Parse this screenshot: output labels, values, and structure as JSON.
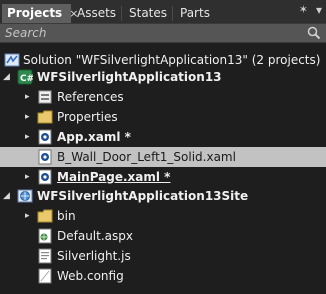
{
  "tabs": [
    {
      "label": "Projects",
      "active": true,
      "close": "×"
    },
    {
      "label": "Assets",
      "active": false
    },
    {
      "label": "States",
      "active": false
    },
    {
      "label": "Parts",
      "active": false
    }
  ],
  "window_controls": {
    "pin": "✶",
    "close": "▾"
  },
  "search": {
    "placeholder": "Search",
    "value": ""
  },
  "tree": {
    "solution": {
      "label": "Solution \"WFSilverlightApplication13\" (2 projects)",
      "icon": "solution-icon"
    },
    "project1": {
      "label": "WFSilverlightApplication13",
      "icon": "project-icon"
    },
    "project1_items": [
      {
        "label": "References",
        "icon": "references-icon"
      },
      {
        "label": "Properties",
        "icon": "folder-icon"
      },
      {
        "label": "App.xaml *",
        "icon": "xaml-file-icon"
      },
      {
        "label": "B_Wall_Door_Left1_Solid.xaml",
        "icon": "xaml-file-icon"
      },
      {
        "label": "MainPage.xaml *",
        "icon": "xaml-file-icon"
      }
    ],
    "project2": {
      "label": "WFSilverlightApplication13Site",
      "icon": "web-project-icon"
    },
    "project2_items": [
      {
        "label": "bin",
        "icon": "folder-icon"
      },
      {
        "label": "Default.aspx",
        "icon": "aspx-file-icon"
      },
      {
        "label": "Silverlight.js",
        "icon": "js-file-icon"
      },
      {
        "label": "Web.config",
        "icon": "config-file-icon"
      }
    ]
  },
  "colors": {
    "background": "#1e1e1e",
    "selected_row": "#c2c2c2",
    "active_tab": "#5f5f5f"
  }
}
